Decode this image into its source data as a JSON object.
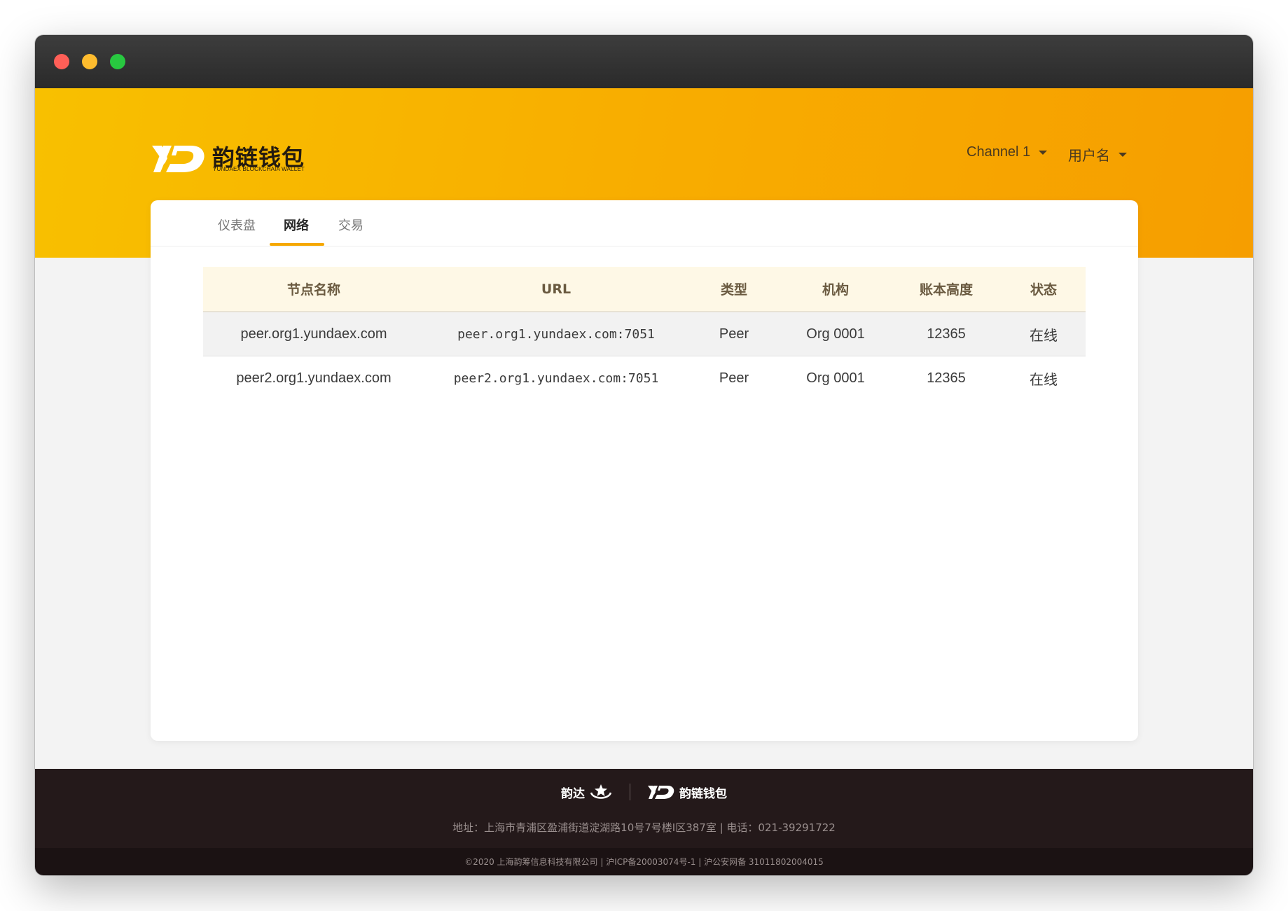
{
  "window": {
    "controls": [
      "close",
      "minimize",
      "maximize"
    ]
  },
  "header": {
    "logo": {
      "title": "韵链钱包",
      "subtitle": "YUNDAEX BLOCKCHAIA WALLET",
      "mark": "YD"
    },
    "channel_menu": {
      "label": "Channel 1",
      "icon": "caret-down-icon"
    },
    "user_menu": {
      "label": "用户名",
      "icon": "caret-down-icon"
    }
  },
  "tabs": [
    {
      "label": "仪表盘",
      "active": false
    },
    {
      "label": "网络",
      "active": true
    },
    {
      "label": "交易",
      "active": false
    }
  ],
  "table": {
    "columns": [
      "节点名称",
      "URL",
      "类型",
      "机构",
      "账本高度",
      "状态"
    ],
    "rows": [
      [
        "peer.org1.yundaex.com",
        "peer.org1.yundaex.com:7051",
        "Peer",
        "Org 0001",
        "12365",
        "在线"
      ],
      [
        "peer2.org1.yundaex.com",
        "peer2.org1.yundaex.com:7051",
        "Peer",
        "Org 0001",
        "12365",
        "在线"
      ]
    ]
  },
  "footer": {
    "brand_left": "韵达",
    "brand_right": "韵链钱包",
    "address": "地址：上海市青浦区盈浦街道淀湖路10号7号楼I区387室 | 电话：021-39291722",
    "copyright": "©2020 上海韵筹信息科技有限公司 | 沪ICP备20003074号-1 | 沪公安网备 31011802004015"
  },
  "colors": {
    "accent": "#f6a800",
    "hero_start": "#f8c000",
    "hero_end": "#f69e00",
    "footer": "#24191a",
    "table_header_bg": "#fef8e6"
  }
}
